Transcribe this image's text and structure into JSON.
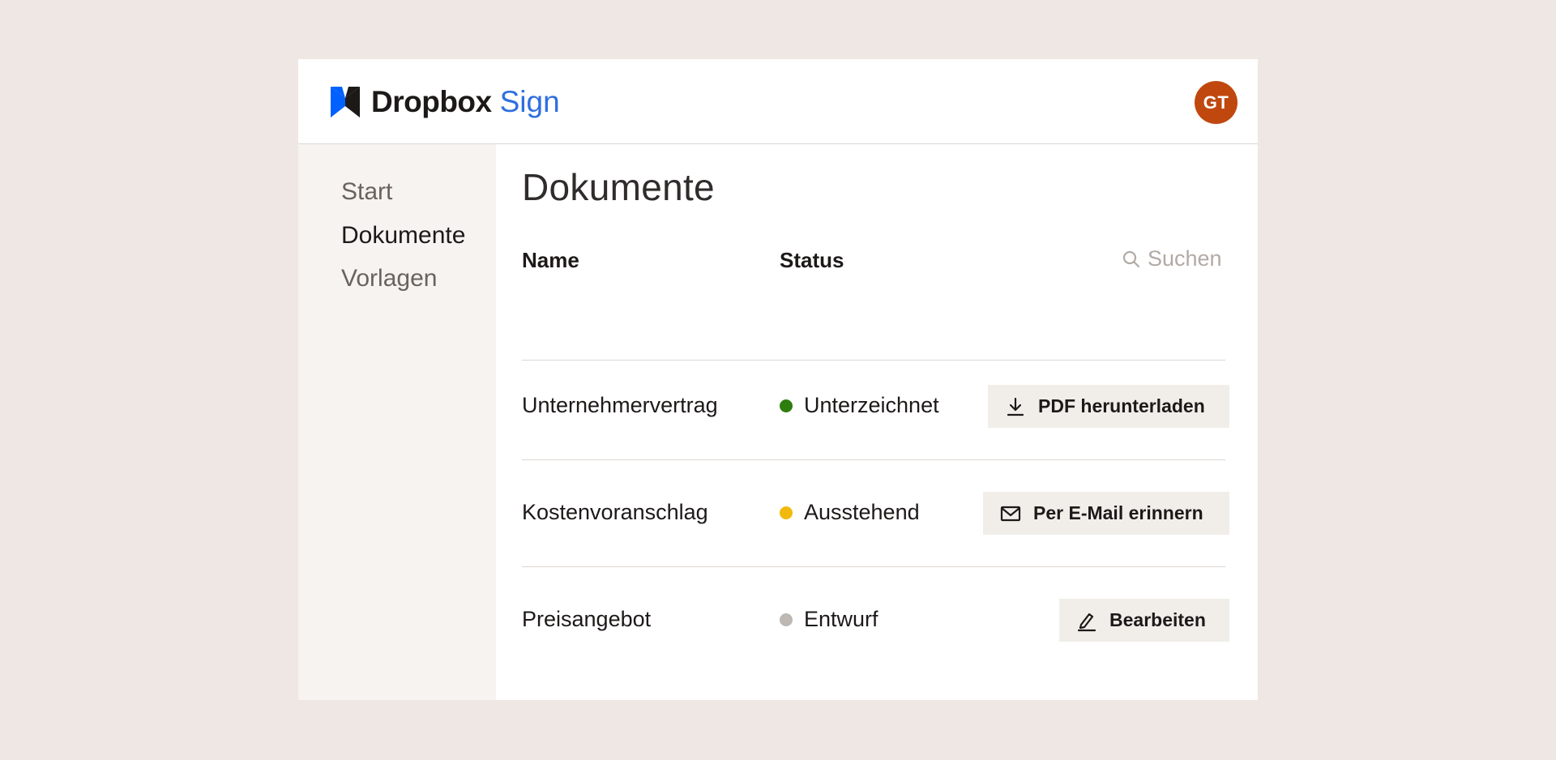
{
  "brand": {
    "word": "Dropbox",
    "product": "Sign",
    "accent": "#2f6fde",
    "mark_color": "#0061fe"
  },
  "user": {
    "initials": "GT",
    "avatar_color": "#c0480f"
  },
  "sidebar": {
    "items": [
      {
        "label": "Start",
        "active": false
      },
      {
        "label": "Dokumente",
        "active": true
      },
      {
        "label": "Vorlagen",
        "active": false
      }
    ]
  },
  "main": {
    "title": "Dokumente",
    "columns": {
      "name": "Name",
      "status": "Status"
    },
    "search": {
      "placeholder": "Suchen",
      "icon": "search-icon"
    },
    "rows": [
      {
        "name": "Unternehmervertrag",
        "status": "Unterzeichnet",
        "status_color": "#2e7d0f",
        "action": "PDF herunterladen",
        "action_icon": "download-icon"
      },
      {
        "name": "Kostenvoranschlag",
        "status": "Ausstehend",
        "status_color": "#f2b90c",
        "action": "Per E-Mail erinnern",
        "action_icon": "mail-icon"
      },
      {
        "name": "Preisangebot",
        "status": "Entwurf",
        "status_color": "#bdb8b4",
        "action": "Bearbeiten",
        "action_icon": "pencil-icon"
      }
    ]
  }
}
